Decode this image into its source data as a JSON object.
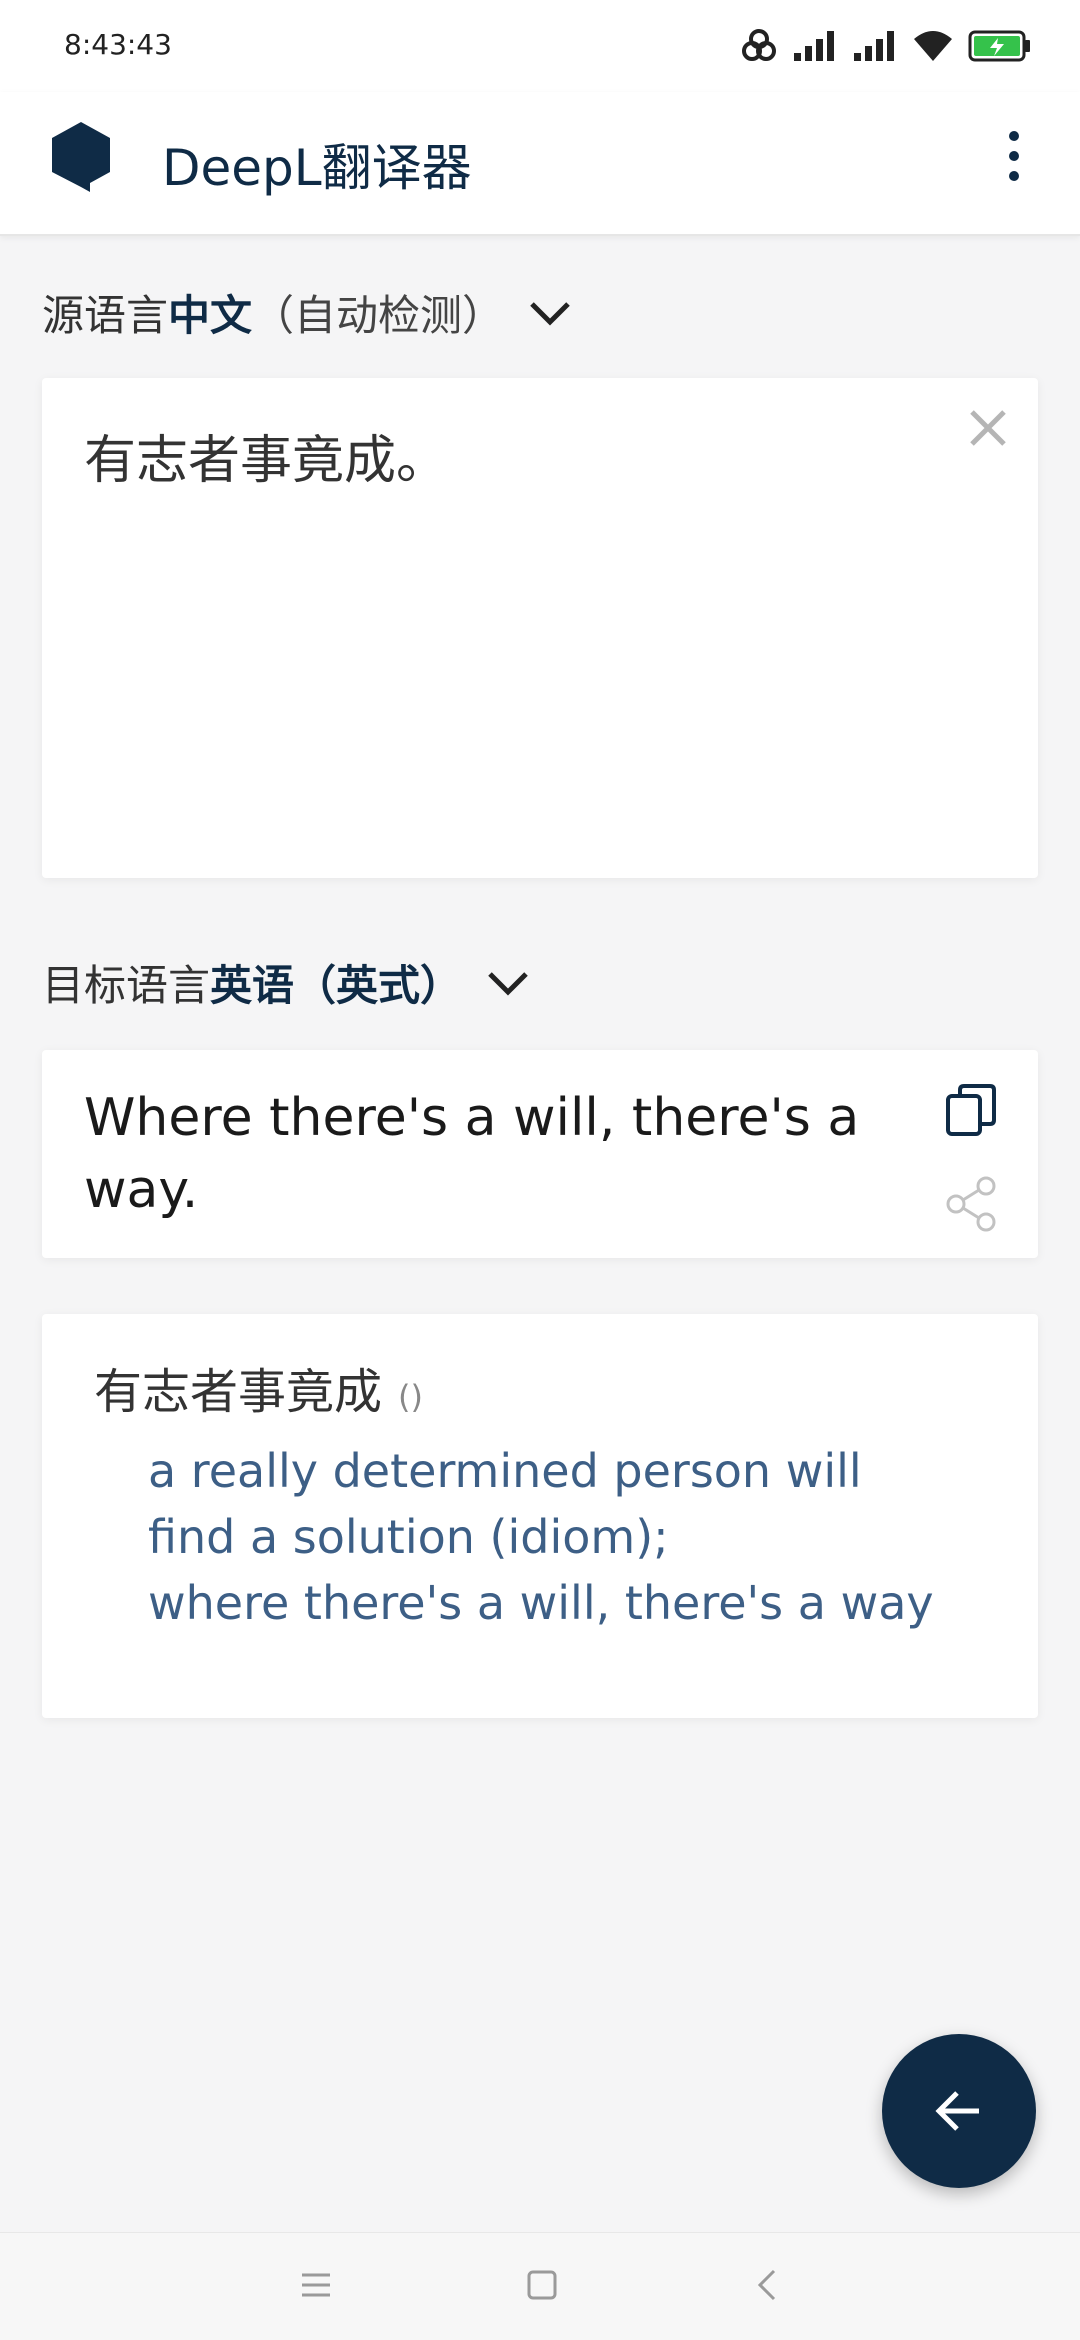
{
  "status_bar": {
    "time": "8:43:43"
  },
  "app_bar": {
    "title": "DeepL翻译器",
    "logo_icon": "deepl-logo-icon",
    "menu_icon": "more-vert-icon"
  },
  "source": {
    "label_prefix": "源语言",
    "language": "中文",
    "auto_detect": "（自动检测）",
    "text": "有志者事竟成。",
    "clear_icon": "close-icon"
  },
  "target": {
    "label_prefix": "目标语言",
    "language": "英语（英式）",
    "text": "Where there's a will, there's a way.",
    "copy_icon": "copy-icon",
    "share_icon": "share-icon"
  },
  "dictionary": {
    "headword": "有志者事竟成",
    "pinyin": "()",
    "definition_lines": [
      "a really determined person will",
      "find a solution (idiom);",
      "where there's a will, there's a way"
    ]
  },
  "fab": {
    "icon": "arrow-back-icon"
  },
  "nav_bar": {
    "icons": [
      "menu-lines-icon",
      "home-square-icon",
      "back-chevron-icon"
    ]
  },
  "colors": {
    "brand": "#0f2b46",
    "definition_text": "#3d5f86",
    "background": "#f5f5f6"
  }
}
